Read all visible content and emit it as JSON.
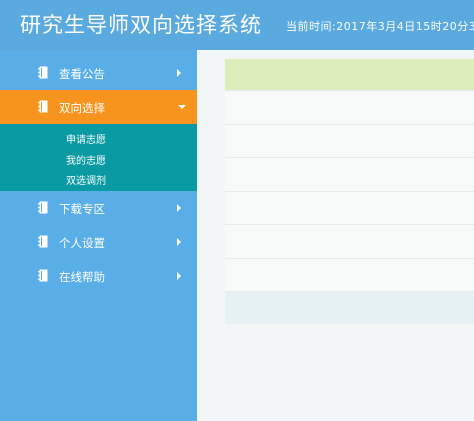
{
  "header": {
    "title": "研究生导师双向选择系统",
    "time": "当前时间:2017年3月4日15时20分3"
  },
  "sidebar": {
    "items": [
      {
        "label": "查看公告",
        "icon": "notebook-icon"
      },
      {
        "label": "双向选择",
        "icon": "notebook-icon",
        "active": true,
        "children": [
          "申请志愿",
          "我的志愿",
          "双选调剂"
        ]
      },
      {
        "label": "下载专区",
        "icon": "notebook-icon"
      },
      {
        "label": "个人设置",
        "icon": "notebook-icon"
      },
      {
        "label": "在线帮助",
        "icon": "notebook-icon"
      }
    ]
  },
  "colors": {
    "header": "#5aaae0",
    "sidebar": "#5aaee8",
    "active": "#f7941d",
    "submenu": "#099aa3",
    "table_head": "#dceebb"
  }
}
